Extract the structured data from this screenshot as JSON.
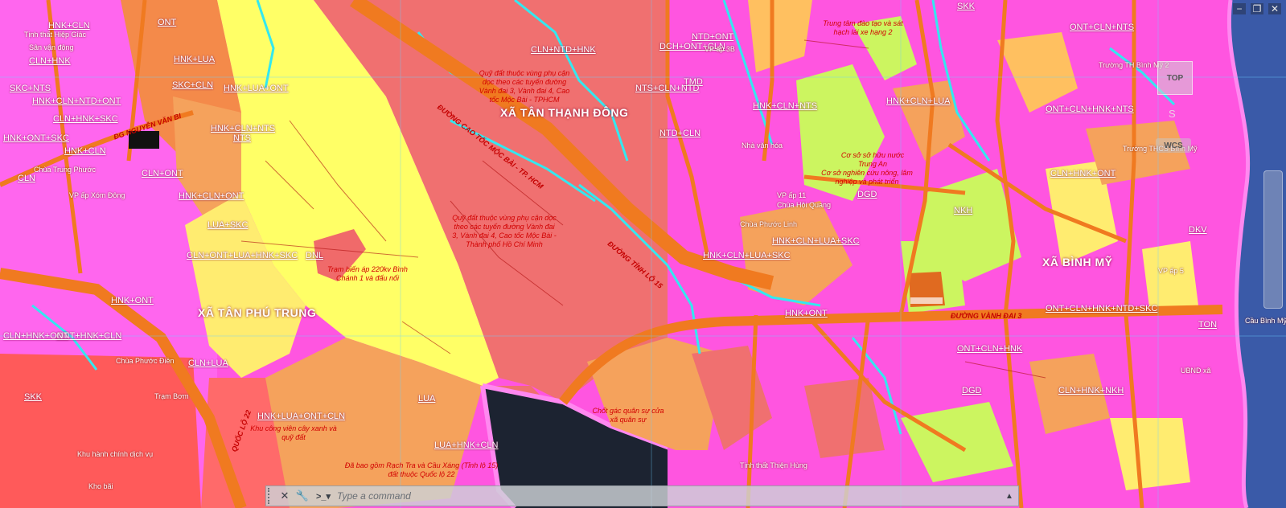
{
  "window_controls": {
    "minimize": "−",
    "restore": "❐",
    "close": "✕"
  },
  "viewcube": {
    "top": "TOP",
    "south": "S",
    "wcs": "WCS"
  },
  "command_line": {
    "placeholder": "Type a command"
  },
  "communes": {
    "tan_thanh_dong": "XÃ TÂN THẠNH ĐÔNG",
    "tan_phu_trung": "XÃ TÂN PHÚ TRUNG",
    "binh_my": "XÃ BÌNH MỸ"
  },
  "roads": {
    "expressway": "ĐƯỜNG CAO TỐC MỘC BÀI - TP. HCM",
    "ring3": "ĐƯỜNG VÀNH ĐAI 3",
    "ql22": "QUỐC LỘ 22",
    "nguyen_van_bi": "ĐG NGUYỄN VĂN BI",
    "tinh_lo_15": "ĐƯỜNG TỈNH LỘ 15"
  },
  "notes": {
    "expressway_reserve_1": "Quỹ đất thuộc vùng phụ cận dọc theo các tuyến đường Vành đai 3, Vành đai 4, Cao tốc Mộc Bài - TPHCM",
    "expressway_reserve_2": "Quỹ đất thuộc vùng phụ cận dọc theo các tuyến đường Vành đai 3, Vành đai 4, Cao tốc Mộc Bài - Thành phố Hồ Chí Minh",
    "substation": "Trạm biến áp 220kv Bình Chánh 1 và đấu nối",
    "research": "Cơ sở nghiên cứu nông, lâm nghiệp và phát triển",
    "water": "Cơ sở sở hữu nước Trung An",
    "market": "Trung tâm đào tạo và sát hạch lái xe hạng 2",
    "military": "Chốt gác quân sự cửa xã quân sự",
    "bridge": "Đã bao gồm Rạch Tra và Cầu Xáng (Tỉnh lộ 15) đất thuộc Quốc lộ 22",
    "industrial": "Khu công viên cây xanh và quỹ đất"
  },
  "zone_labels": [
    "HNK+CLN",
    "CLN+HNK",
    "SKC+NTS",
    "HNK+CLN+NTD+ONT",
    "CLN+HNK+SKC",
    "HNK+ONT+SKC",
    "HNK+CLN",
    "CLN",
    "CLN+ONT",
    "ONT",
    "HNK+LUA",
    "SKC+CLN",
    "HNK+LUA+ONT",
    "HNK+CLN+NTS",
    "LUA+SKC",
    "HNK+CLN+ONT",
    "CLN+ONT+LUA+HNK+SKC",
    "DNL",
    "LUA",
    "SKK",
    "HNK+LUA+ONT+CLN",
    "LUA+HNK+CLN",
    "CLN+NTD+HNK",
    "ONT+HNK+CLN",
    "CLN+HNK+ONT",
    "HNK+ONT",
    "CLN+LUA",
    "NTS",
    "TMD",
    "DGD",
    "NKH",
    "HNK+CLN+LUA",
    "NTD+ONT",
    "DCH+ONT+CLN",
    "NTD+CLN",
    "NTS+CLN+NTD",
    "HNK+CLN+NTS",
    "HNK+CLN+LUA+SKC",
    "HNK+CLN+LUA+SKC",
    "HNK+ONT",
    "ONT+CLN+HNK+NTS",
    "ONT+CLN+HNK+NTD+SKC",
    "CLN+HNK+ONT",
    "ONT+CLN+HNK",
    "CLN+HNK+NKH",
    "ONT+CLN+NTS",
    "DGD",
    "DKV",
    "TON",
    "SKK"
  ],
  "places": [
    "Tịnh thất Hiệp Giác",
    "Sân vận động",
    "Chùa Trung Phước",
    "VP ấp Xóm Đông",
    "VP ấp 3B",
    "Nhà văn hóa",
    "Trường TH Bình Mỹ 2",
    "Trường THCS Bình Mỹ",
    "VP ấp 5",
    "UBND xã",
    "Cầu Bình Mỹ",
    "Chùa Phước Linh",
    "Chùa Hội Quang",
    "Trạm Bơm",
    "Khu hành chính dịch vụ",
    "Kho bãi",
    "VP ấp 11",
    "Chùa Phước Điền",
    "Tịnh thất Thiện Hùng"
  ]
}
